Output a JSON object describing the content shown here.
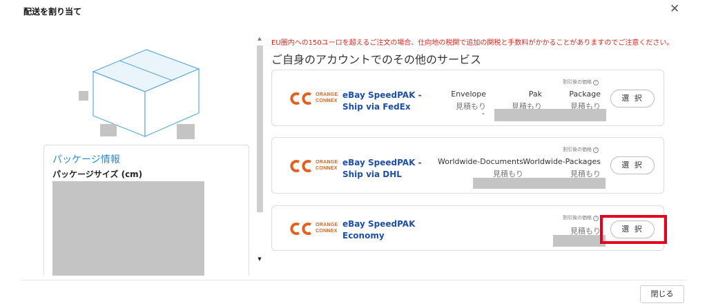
{
  "dialog": {
    "title": "配送を割り当て",
    "close_icon": "close-icon"
  },
  "package_panel": {
    "title": "パッケージ情報",
    "size_label": "パッケージサイズ (cm)"
  },
  "notice": "EU圏内への150ユーロを超えるご注文の場合、仕向地の税関で追加の関税と手数料がかかることがありますのでご注意ください。",
  "section_title": "ご自身のアカウントでのその他のサービス",
  "services": [
    {
      "logo_text_1": "ORANGE",
      "logo_text_2": "CONNEX",
      "name_line1": "eBay SpeedPAK -",
      "name_line2": "Ship via FedEx",
      "price_header": "割引後の価格",
      "columns": [
        {
          "label": "Envelope",
          "value": "見積もり"
        },
        {
          "label": "Pak",
          "value": "見積もり"
        },
        {
          "label": "Package",
          "value": "見積もり"
        }
      ],
      "dash": "-",
      "select_label": "選 択"
    },
    {
      "logo_text_1": "ORANGE",
      "logo_text_2": "CONNEX",
      "name_line1": "eBay SpeedPAK -",
      "name_line2": "Ship via DHL",
      "price_header": "割引後の価格",
      "columns": [
        {
          "label": "Worldwide-Documents",
          "value": "見積もり"
        },
        {
          "label": "Worldwide-Packages",
          "value": "見積もり"
        }
      ],
      "select_label": "選 択"
    },
    {
      "logo_text_1": "ORANGE",
      "logo_text_2": "CONNEX",
      "name_line1": "eBay SpeedPAK",
      "name_line2": "Economy",
      "price_header": "割引後の価格",
      "columns": [
        {
          "label": "",
          "value": "見積もり"
        }
      ],
      "select_label": "選 択"
    }
  ],
  "footer": {
    "close_label": "閉じる"
  },
  "colors": {
    "accent_blue": "#1d4fa8",
    "notice_red": "#e0241b",
    "brand_orange": "#e2611f",
    "highlight_red": "#e6001e"
  }
}
